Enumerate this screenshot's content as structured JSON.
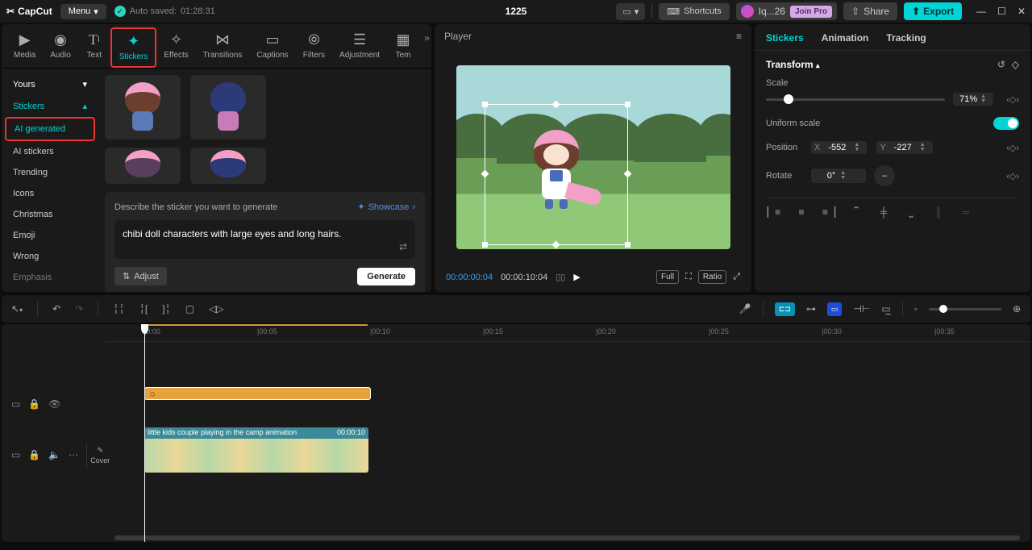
{
  "app": {
    "name": "CapCut",
    "menu_label": "Menu",
    "autosave_prefix": "Auto saved:",
    "autosave_time": "01:28:31",
    "project_title": "1225"
  },
  "titlebar": {
    "shortcuts": "Shortcuts",
    "user": "Iq...26",
    "join_pro": "Join Pro",
    "share": "Share",
    "export": "Export"
  },
  "mediaTabs": [
    {
      "label": "Media"
    },
    {
      "label": "Audio"
    },
    {
      "label": "Text"
    },
    {
      "label": "Stickers"
    },
    {
      "label": "Effects"
    },
    {
      "label": "Transitions"
    },
    {
      "label": "Captions"
    },
    {
      "label": "Filters"
    },
    {
      "label": "Adjustment"
    },
    {
      "label": "Tem"
    }
  ],
  "categories": {
    "yours": "Yours",
    "stickers": "Stickers",
    "ai_generated": "AI generated",
    "ai_stickers": "AI stickers",
    "trending": "Trending",
    "icons": "Icons",
    "christmas": "Christmas",
    "emoji": "Emoji",
    "wrong": "Wrong",
    "emphasis": "Emphasis"
  },
  "generator": {
    "describe_label": "Describe the sticker you want to generate",
    "showcase": "Showcase",
    "prompt": "chibi doll characters with large eyes and long hairs.",
    "adjust": "Adjust",
    "generate": "Generate"
  },
  "player": {
    "title": "Player",
    "cur_time": "00:00:00:04",
    "duration": "00:00:10:04",
    "full": "Full",
    "ratio": "Ratio"
  },
  "inspector": {
    "tabs": {
      "stickers": "Stickers",
      "animation": "Animation",
      "tracking": "Tracking"
    },
    "transform": "Transform",
    "scale": "Scale",
    "scale_value": "71%",
    "uniform_scale": "Uniform scale",
    "position": "Position",
    "pos_x_label": "X",
    "pos_x": "-552",
    "pos_y_label": "Y",
    "pos_y": "-227",
    "rotate": "Rotate",
    "rotate_value": "0°",
    "flip": "–"
  },
  "timeline": {
    "ticks": [
      "|0:00",
      "|00:05",
      "|00:10",
      "|00:15",
      "|00:20",
      "|00:25",
      "|00:30",
      "|00:35"
    ],
    "cover": "Cover",
    "video_clip_label": "little kids couple playing in the camp animation",
    "video_clip_time": "00:00:10"
  }
}
